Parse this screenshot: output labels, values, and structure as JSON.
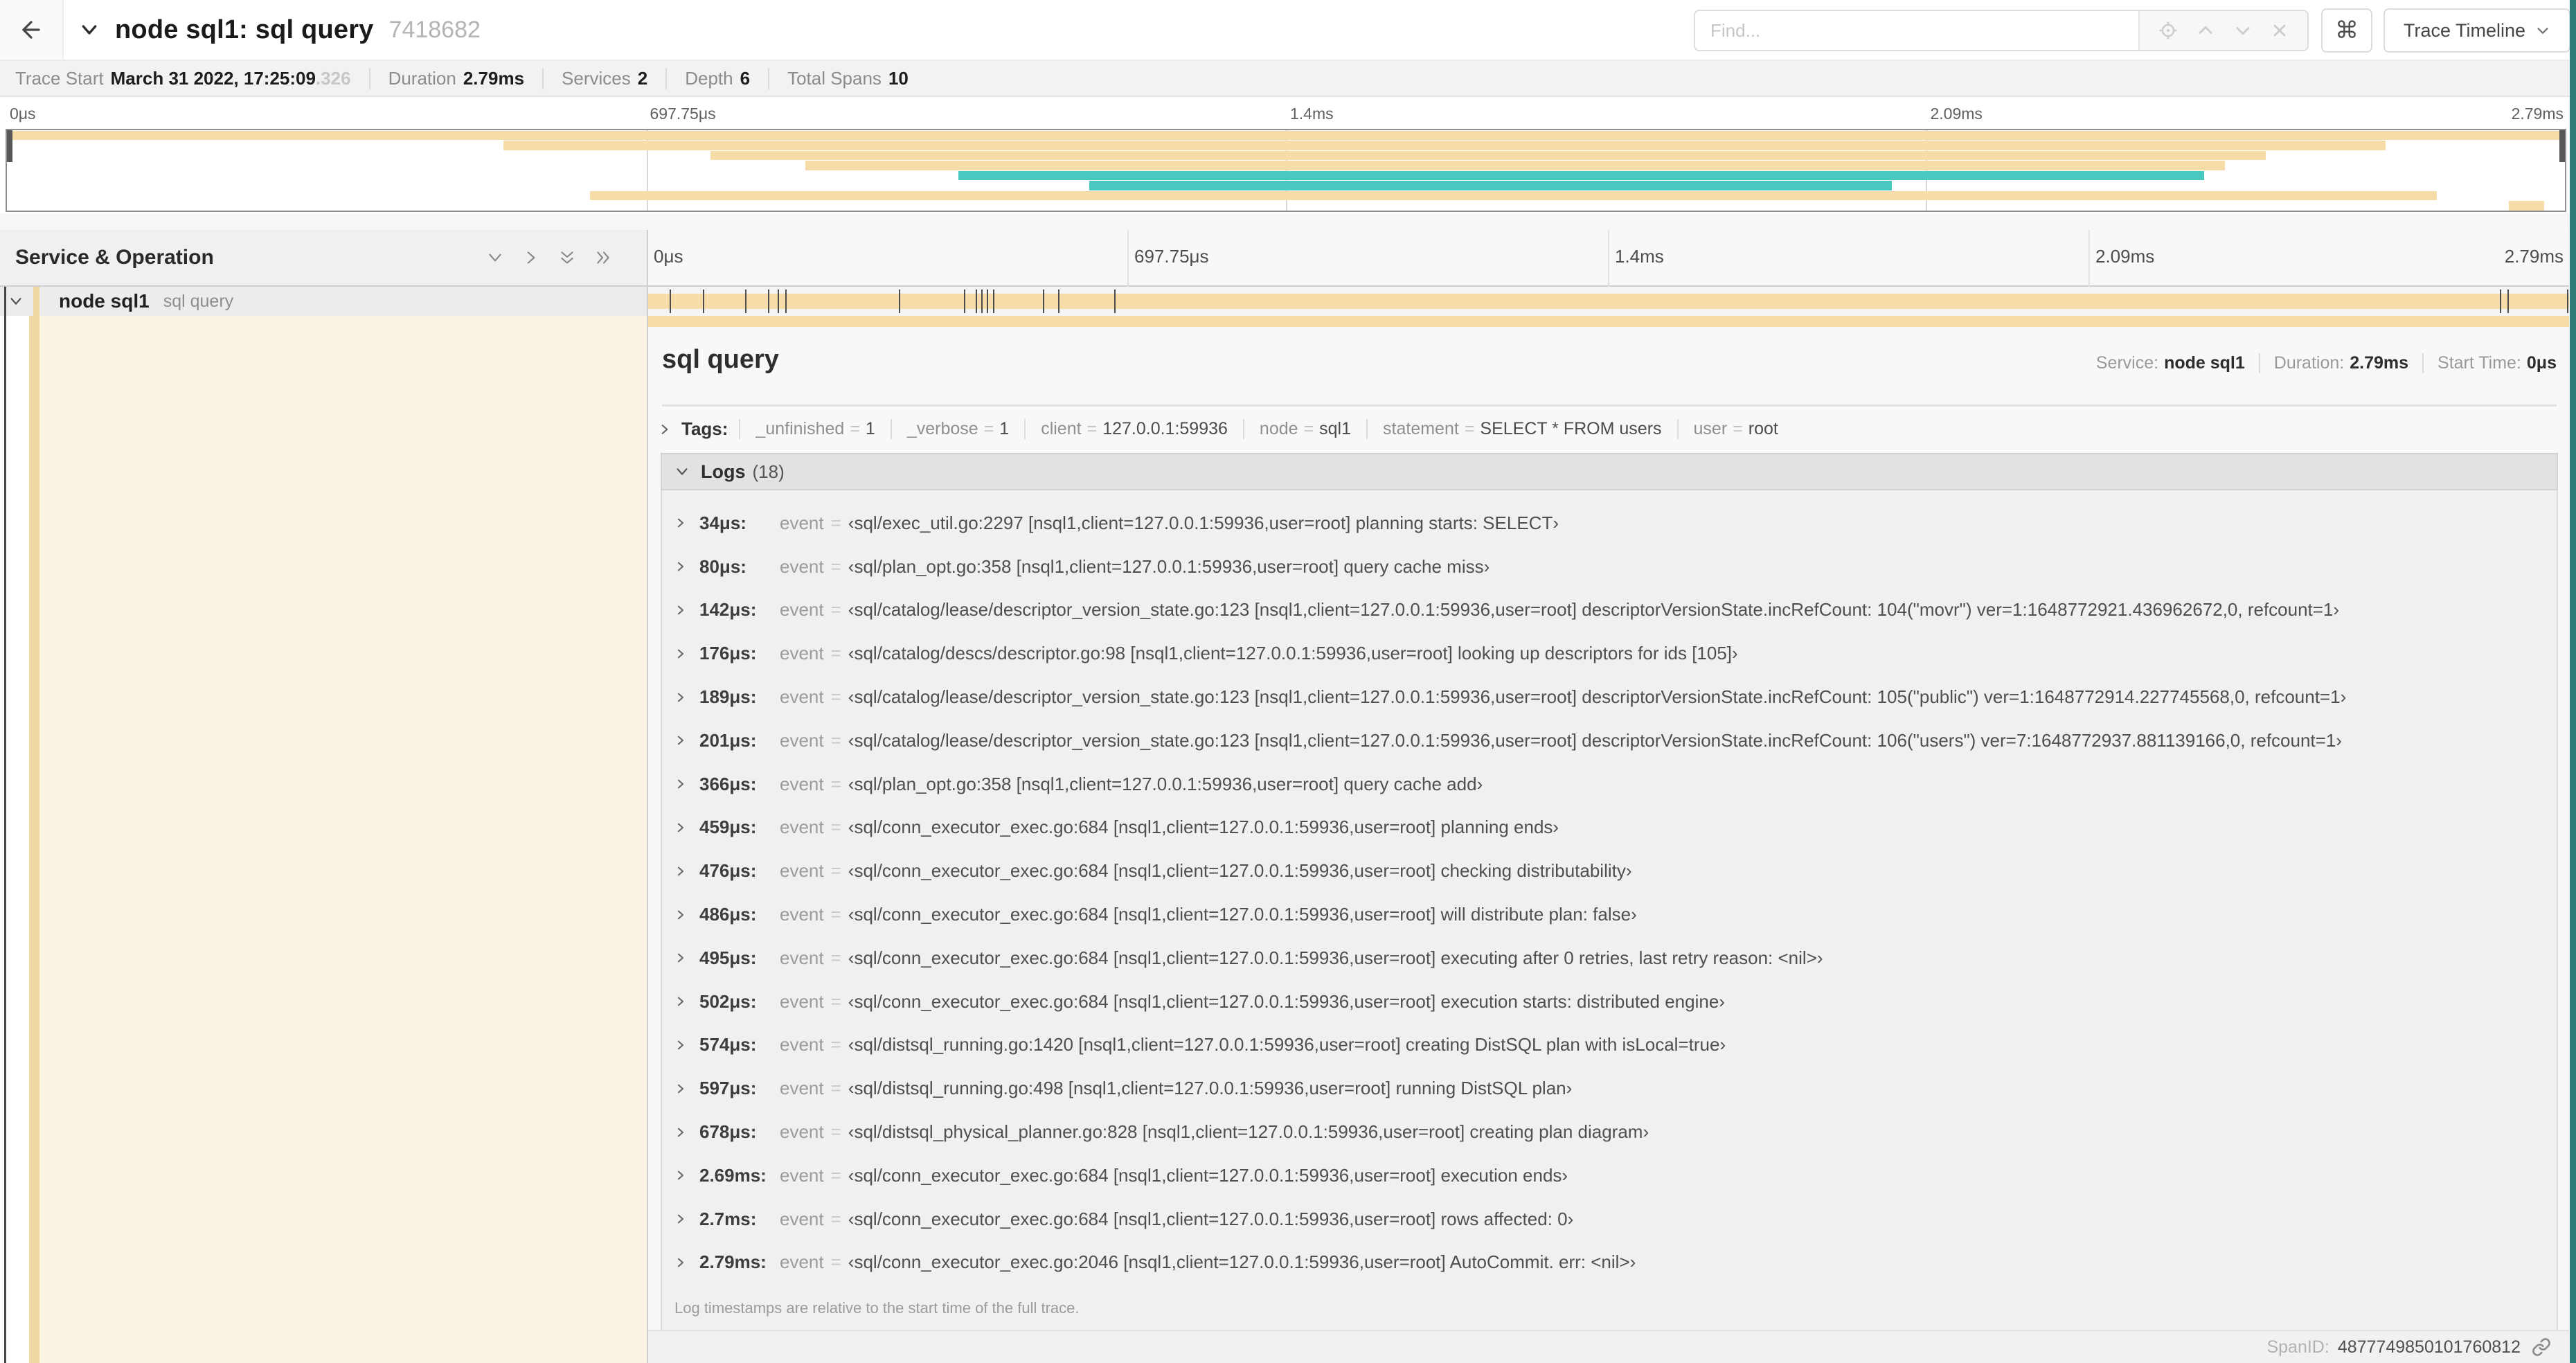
{
  "header": {
    "title": "node sql1: sql query",
    "trace_id_short": "7418682",
    "find_placeholder": "Find...",
    "shortcut_icon": "⌘",
    "view_selector_label": "Trace Timeline"
  },
  "trace_meta": {
    "items": [
      {
        "label": "Trace Start",
        "value": "March 31 2022, 17:25:09",
        "suffix": ".326"
      },
      {
        "label": "Duration",
        "value": "2.79ms",
        "suffix": ""
      },
      {
        "label": "Services",
        "value": "2",
        "suffix": ""
      },
      {
        "label": "Depth",
        "value": "6",
        "suffix": ""
      },
      {
        "label": "Total Spans",
        "value": "10",
        "suffix": ""
      }
    ]
  },
  "timeline": {
    "ticks": [
      {
        "label": "0μs",
        "pct": 0
      },
      {
        "label": "697.75μs",
        "pct": 25
      },
      {
        "label": "1.4ms",
        "pct": 50
      },
      {
        "label": "2.09ms",
        "pct": 75
      },
      {
        "label": "2.79ms",
        "pct": 100
      }
    ],
    "gridline_pcts": [
      25,
      50,
      75
    ],
    "header_left": "Service & Operation"
  },
  "minimap": {
    "spans": [
      {
        "start_pct": 0,
        "end_pct": 100,
        "color": "tan"
      },
      {
        "start_pct": 19.4,
        "end_pct": 93,
        "color": "tan"
      },
      {
        "start_pct": 27.5,
        "end_pct": 88.3,
        "color": "tan"
      },
      {
        "start_pct": 31.2,
        "end_pct": 86.7,
        "color": "tan"
      },
      {
        "start_pct": 37.2,
        "end_pct": 85.9,
        "color": "teal"
      },
      {
        "start_pct": 42.3,
        "end_pct": 73.7,
        "color": "teal"
      },
      {
        "start_pct": 22.8,
        "end_pct": 95,
        "color": "tan"
      },
      {
        "start_pct": 97.8,
        "end_pct": 99.2,
        "color": "tan"
      }
    ]
  },
  "span_row": {
    "service": "node sql1",
    "operation": "sql query",
    "log_marks_pct": [
      1.2,
      2.9,
      5.1,
      6.3,
      6.8,
      7.2,
      13.1,
      16.5,
      17.1,
      17.4,
      17.7,
      18.0,
      20.6,
      21.4,
      24.3,
      96.4,
      96.8,
      99.9
    ]
  },
  "detail": {
    "title": "sql query",
    "meta": [
      {
        "label": "Service:",
        "value": "node sql1"
      },
      {
        "label": "Duration:",
        "value": "2.79ms"
      },
      {
        "label": "Start Time:",
        "value": "0μs"
      }
    ],
    "tags": {
      "label": "Tags:",
      "items": [
        {
          "key": "_unfinished",
          "value": "1"
        },
        {
          "key": "_verbose",
          "value": "1"
        },
        {
          "key": "client",
          "value": "127.0.0.1:59936"
        },
        {
          "key": "node",
          "value": "sql1"
        },
        {
          "key": "statement",
          "value": "SELECT * FROM users"
        },
        {
          "key": "user",
          "value": "root"
        }
      ]
    },
    "logs": {
      "label": "Logs",
      "count": "(18)",
      "entries": [
        {
          "t": "34μs:",
          "k": "event",
          "v": "‹sql/exec_util.go:2297 [nsql1,client=127.0.0.1:59936,user=root] planning starts: SELECT›"
        },
        {
          "t": "80μs:",
          "k": "event",
          "v": "‹sql/plan_opt.go:358 [nsql1,client=127.0.0.1:59936,user=root] query cache miss›"
        },
        {
          "t": "142μs:",
          "k": "event",
          "v": "‹sql/catalog/lease/descriptor_version_state.go:123 [nsql1,client=127.0.0.1:59936,user=root] descriptorVersionState.incRefCount: 104(\"movr\") ver=1:1648772921.436962672,0, refcount=1›"
        },
        {
          "t": "176μs:",
          "k": "event",
          "v": "‹sql/catalog/descs/descriptor.go:98 [nsql1,client=127.0.0.1:59936,user=root] looking up descriptors for ids [105]›"
        },
        {
          "t": "189μs:",
          "k": "event",
          "v": "‹sql/catalog/lease/descriptor_version_state.go:123 [nsql1,client=127.0.0.1:59936,user=root] descriptorVersionState.incRefCount: 105(\"public\") ver=1:1648772914.227745568,0, refcount=1›"
        },
        {
          "t": "201μs:",
          "k": "event",
          "v": "‹sql/catalog/lease/descriptor_version_state.go:123 [nsql1,client=127.0.0.1:59936,user=root] descriptorVersionState.incRefCount: 106(\"users\") ver=7:1648772937.881139166,0, refcount=1›"
        },
        {
          "t": "366μs:",
          "k": "event",
          "v": "‹sql/plan_opt.go:358 [nsql1,client=127.0.0.1:59936,user=root] query cache add›"
        },
        {
          "t": "459μs:",
          "k": "event",
          "v": "‹sql/conn_executor_exec.go:684 [nsql1,client=127.0.0.1:59936,user=root] planning ends›"
        },
        {
          "t": "476μs:",
          "k": "event",
          "v": "‹sql/conn_executor_exec.go:684 [nsql1,client=127.0.0.1:59936,user=root] checking distributability›"
        },
        {
          "t": "486μs:",
          "k": "event",
          "v": "‹sql/conn_executor_exec.go:684 [nsql1,client=127.0.0.1:59936,user=root] will distribute plan: false›"
        },
        {
          "t": "495μs:",
          "k": "event",
          "v": "‹sql/conn_executor_exec.go:684 [nsql1,client=127.0.0.1:59936,user=root] executing after 0 retries, last retry reason: <nil>›"
        },
        {
          "t": "502μs:",
          "k": "event",
          "v": "‹sql/conn_executor_exec.go:684 [nsql1,client=127.0.0.1:59936,user=root] execution starts: distributed engine›"
        },
        {
          "t": "574μs:",
          "k": "event",
          "v": "‹sql/distsql_running.go:1420 [nsql1,client=127.0.0.1:59936,user=root] creating DistSQL plan with isLocal=true›"
        },
        {
          "t": "597μs:",
          "k": "event",
          "v": "‹sql/distsql_running.go:498 [nsql1,client=127.0.0.1:59936,user=root] running DistSQL plan›"
        },
        {
          "t": "678μs:",
          "k": "event",
          "v": "‹sql/distsql_physical_planner.go:828 [nsql1,client=127.0.0.1:59936,user=root] creating plan diagram›"
        },
        {
          "t": "2.69ms:",
          "k": "event",
          "v": "‹sql/conn_executor_exec.go:684 [nsql1,client=127.0.0.1:59936,user=root] execution ends›"
        },
        {
          "t": "2.7ms:",
          "k": "event",
          "v": "‹sql/conn_executor_exec.go:684 [nsql1,client=127.0.0.1:59936,user=root] rows affected: 0›"
        },
        {
          "t": "2.79ms:",
          "k": "event",
          "v": "‹sql/conn_executor_exec.go:2046 [nsql1,client=127.0.0.1:59936,user=root] AutoCommit. err: <nil>›"
        }
      ],
      "note": "Log timestamps are relative to the start time of the full trace."
    },
    "footer": {
      "label": "SpanID:",
      "value": "4877749850101760812"
    }
  },
  "strings": {
    "eq": "="
  },
  "colors": {
    "tan": "#f6dca6",
    "tan_strip": "#f0d9a2",
    "tan_light": "#faf3e2",
    "teal": "#49c8bf",
    "scrollbar": "#2e7d7b"
  }
}
